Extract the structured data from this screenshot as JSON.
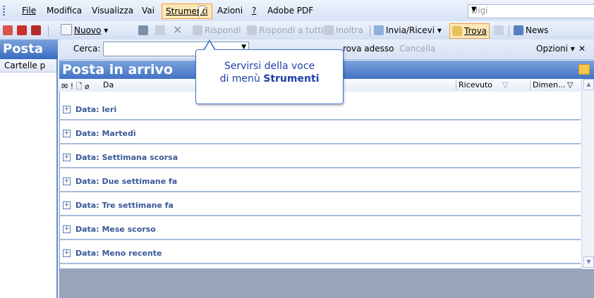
{
  "menubar": {
    "items": [
      {
        "label": "File"
      },
      {
        "label": "Modifica"
      },
      {
        "label": "Visualizza"
      },
      {
        "label": "Vai"
      },
      {
        "label": "Strumenti"
      },
      {
        "label": "Azioni"
      },
      {
        "label": "?"
      },
      {
        "label": "Adobe PDF"
      }
    ],
    "search_placeholder": "Digi"
  },
  "toolbar": {
    "nuovo": "Nuovo",
    "rispondi": "Rispondi",
    "rispondi_tutti": "Rispondi a tutti",
    "inoltra": "Inoltra",
    "invia_ricevi": "Invia/Ricevi",
    "trova": "Trova",
    "news": "News"
  },
  "findbar": {
    "cerca_label": "Cerca:",
    "trova_adesso": "rova adesso",
    "cancella": "Cancella",
    "opzioni": "Opzioni"
  },
  "nav": {
    "title": "Posta",
    "section": "Cartelle p"
  },
  "main": {
    "title": "Posta in arrivo",
    "columns": {
      "from": "Da",
      "received": "Ricevuto",
      "size": "Dimen..."
    },
    "groups": [
      {
        "label": "Data: Ieri"
      },
      {
        "label": "Data: Martedì"
      },
      {
        "label": "Data: Settimana scorsa"
      },
      {
        "label": "Data: Due settimane fa"
      },
      {
        "label": "Data: Tre settimane fa"
      },
      {
        "label": "Data: Mese scorso"
      },
      {
        "label": "Data: Meno recente"
      }
    ]
  },
  "callout": {
    "line1": "Servirsi della voce",
    "line2_prefix": "di menù",
    "line2_strong": "Strumenti"
  }
}
